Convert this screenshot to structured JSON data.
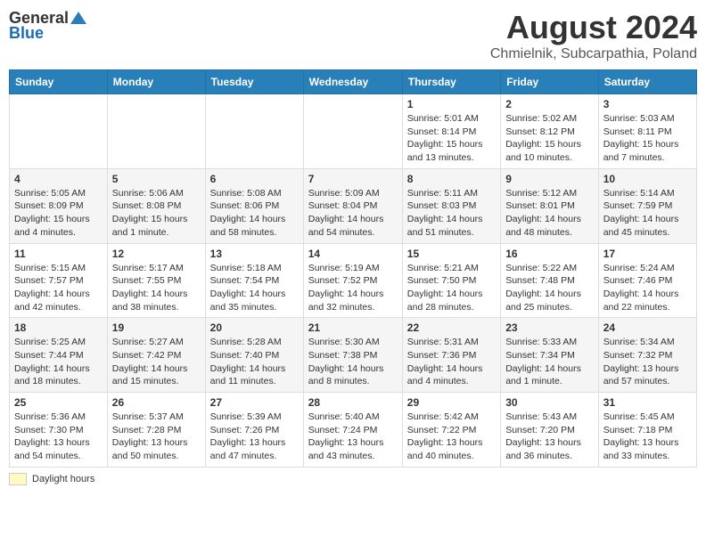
{
  "logo": {
    "general": "General",
    "blue": "Blue"
  },
  "title": "August 2024",
  "subtitle": "Chmielnik, Subcarpathia, Poland",
  "days_of_week": [
    "Sunday",
    "Monday",
    "Tuesday",
    "Wednesday",
    "Thursday",
    "Friday",
    "Saturday"
  ],
  "weeks": [
    [
      {
        "day": "",
        "info": ""
      },
      {
        "day": "",
        "info": ""
      },
      {
        "day": "",
        "info": ""
      },
      {
        "day": "",
        "info": ""
      },
      {
        "day": "1",
        "info": "Sunrise: 5:01 AM\nSunset: 8:14 PM\nDaylight: 15 hours and 13 minutes."
      },
      {
        "day": "2",
        "info": "Sunrise: 5:02 AM\nSunset: 8:12 PM\nDaylight: 15 hours and 10 minutes."
      },
      {
        "day": "3",
        "info": "Sunrise: 5:03 AM\nSunset: 8:11 PM\nDaylight: 15 hours and 7 minutes."
      }
    ],
    [
      {
        "day": "4",
        "info": "Sunrise: 5:05 AM\nSunset: 8:09 PM\nDaylight: 15 hours and 4 minutes."
      },
      {
        "day": "5",
        "info": "Sunrise: 5:06 AM\nSunset: 8:08 PM\nDaylight: 15 hours and 1 minute."
      },
      {
        "day": "6",
        "info": "Sunrise: 5:08 AM\nSunset: 8:06 PM\nDaylight: 14 hours and 58 minutes."
      },
      {
        "day": "7",
        "info": "Sunrise: 5:09 AM\nSunset: 8:04 PM\nDaylight: 14 hours and 54 minutes."
      },
      {
        "day": "8",
        "info": "Sunrise: 5:11 AM\nSunset: 8:03 PM\nDaylight: 14 hours and 51 minutes."
      },
      {
        "day": "9",
        "info": "Sunrise: 5:12 AM\nSunset: 8:01 PM\nDaylight: 14 hours and 48 minutes."
      },
      {
        "day": "10",
        "info": "Sunrise: 5:14 AM\nSunset: 7:59 PM\nDaylight: 14 hours and 45 minutes."
      }
    ],
    [
      {
        "day": "11",
        "info": "Sunrise: 5:15 AM\nSunset: 7:57 PM\nDaylight: 14 hours and 42 minutes."
      },
      {
        "day": "12",
        "info": "Sunrise: 5:17 AM\nSunset: 7:55 PM\nDaylight: 14 hours and 38 minutes."
      },
      {
        "day": "13",
        "info": "Sunrise: 5:18 AM\nSunset: 7:54 PM\nDaylight: 14 hours and 35 minutes."
      },
      {
        "day": "14",
        "info": "Sunrise: 5:19 AM\nSunset: 7:52 PM\nDaylight: 14 hours and 32 minutes."
      },
      {
        "day": "15",
        "info": "Sunrise: 5:21 AM\nSunset: 7:50 PM\nDaylight: 14 hours and 28 minutes."
      },
      {
        "day": "16",
        "info": "Sunrise: 5:22 AM\nSunset: 7:48 PM\nDaylight: 14 hours and 25 minutes."
      },
      {
        "day": "17",
        "info": "Sunrise: 5:24 AM\nSunset: 7:46 PM\nDaylight: 14 hours and 22 minutes."
      }
    ],
    [
      {
        "day": "18",
        "info": "Sunrise: 5:25 AM\nSunset: 7:44 PM\nDaylight: 14 hours and 18 minutes."
      },
      {
        "day": "19",
        "info": "Sunrise: 5:27 AM\nSunset: 7:42 PM\nDaylight: 14 hours and 15 minutes."
      },
      {
        "day": "20",
        "info": "Sunrise: 5:28 AM\nSunset: 7:40 PM\nDaylight: 14 hours and 11 minutes."
      },
      {
        "day": "21",
        "info": "Sunrise: 5:30 AM\nSunset: 7:38 PM\nDaylight: 14 hours and 8 minutes."
      },
      {
        "day": "22",
        "info": "Sunrise: 5:31 AM\nSunset: 7:36 PM\nDaylight: 14 hours and 4 minutes."
      },
      {
        "day": "23",
        "info": "Sunrise: 5:33 AM\nSunset: 7:34 PM\nDaylight: 14 hours and 1 minute."
      },
      {
        "day": "24",
        "info": "Sunrise: 5:34 AM\nSunset: 7:32 PM\nDaylight: 13 hours and 57 minutes."
      }
    ],
    [
      {
        "day": "25",
        "info": "Sunrise: 5:36 AM\nSunset: 7:30 PM\nDaylight: 13 hours and 54 minutes."
      },
      {
        "day": "26",
        "info": "Sunrise: 5:37 AM\nSunset: 7:28 PM\nDaylight: 13 hours and 50 minutes."
      },
      {
        "day": "27",
        "info": "Sunrise: 5:39 AM\nSunset: 7:26 PM\nDaylight: 13 hours and 47 minutes."
      },
      {
        "day": "28",
        "info": "Sunrise: 5:40 AM\nSunset: 7:24 PM\nDaylight: 13 hours and 43 minutes."
      },
      {
        "day": "29",
        "info": "Sunrise: 5:42 AM\nSunset: 7:22 PM\nDaylight: 13 hours and 40 minutes."
      },
      {
        "day": "30",
        "info": "Sunrise: 5:43 AM\nSunset: 7:20 PM\nDaylight: 13 hours and 36 minutes."
      },
      {
        "day": "31",
        "info": "Sunrise: 5:45 AM\nSunset: 7:18 PM\nDaylight: 13 hours and 33 minutes."
      }
    ]
  ],
  "footer": {
    "daylight_label": "Daylight hours"
  }
}
